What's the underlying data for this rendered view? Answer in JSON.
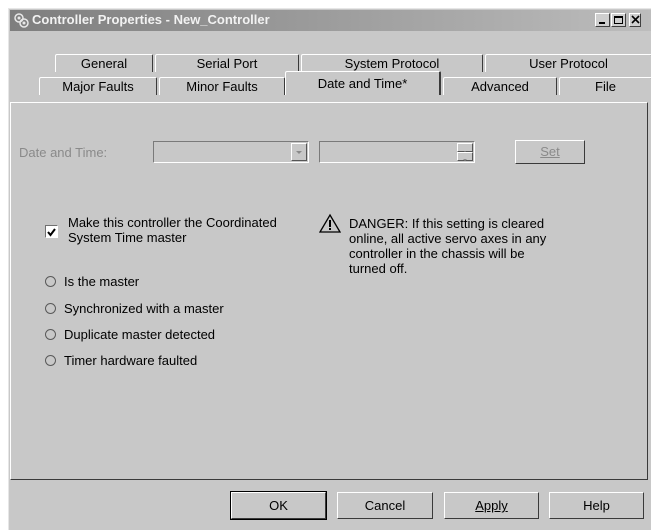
{
  "window": {
    "title": "Controller Properties - New_Controller",
    "icon": "controller-icon"
  },
  "title_buttons": [
    "minimize",
    "maximize",
    "close"
  ],
  "tabs_row1": [
    "General",
    "Serial Port",
    "System Protocol",
    "User Protocol"
  ],
  "tabs_row2": [
    "Major Faults",
    "Minor Faults",
    "Date and Time*",
    "Advanced",
    "File"
  ],
  "active_tab": "Date and Time*",
  "date_time": {
    "label": "Date and Time:",
    "date_value": "",
    "time_value": "",
    "set_button": "Set"
  },
  "cst": {
    "checkbox_label_line1": "Make this controller the Coordinated",
    "checkbox_label_line2": "System Time master",
    "checked": true
  },
  "warning": {
    "icon": "warning-icon",
    "text_line1": "DANGER: If this setting is cleared",
    "text_line2": "online, all active servo axes in any",
    "text_line3": "controller in the chassis will be",
    "text_line4": "turned off."
  },
  "status_radios": [
    "Is the master",
    "Synchronized with a master",
    "Duplicate master detected",
    "Timer hardware faulted"
  ],
  "footer_buttons": {
    "ok": "OK",
    "cancel": "Cancel",
    "apply": "Apply",
    "help": "Help"
  }
}
